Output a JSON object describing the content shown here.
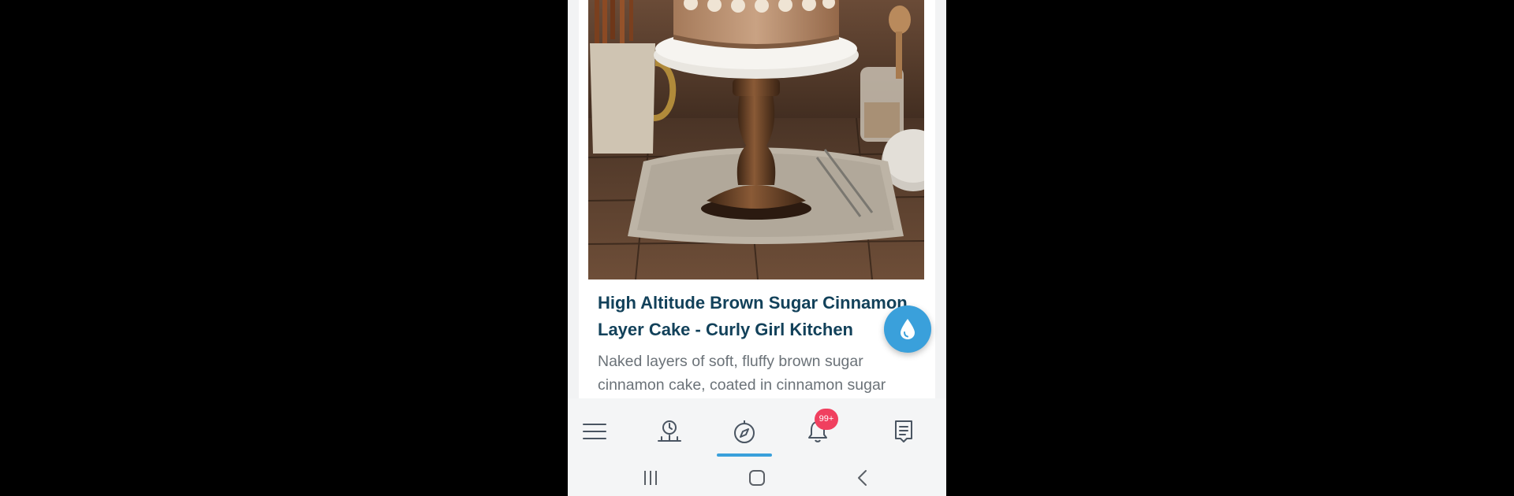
{
  "article": {
    "title": "High Altitude Brown Sugar Cinnamon Layer Cake - Curly Girl Kitchen",
    "description": "Naked layers of soft, fluffy brown sugar cinnamon cake, coated in cinnamon sugar",
    "image_alt": "Brown sugar cinnamon layer cake on a marble and wood cake stand"
  },
  "fab": {
    "icon": "water-drop-icon",
    "color": "#3aa0db"
  },
  "bottom_nav": {
    "items": [
      {
        "id": "menu",
        "icon": "hamburger-menu-icon"
      },
      {
        "id": "timeline",
        "icon": "clock-timeline-icon"
      },
      {
        "id": "discover",
        "icon": "compass-icon",
        "active": true
      },
      {
        "id": "notifications",
        "icon": "bell-icon",
        "badge": "99+"
      },
      {
        "id": "notes",
        "icon": "note-icon"
      }
    ],
    "accent_color": "#3aa0db",
    "badge_color": "#f0405f"
  },
  "system_nav": {
    "items": [
      {
        "id": "recents",
        "icon": "recents-icon"
      },
      {
        "id": "home",
        "icon": "home-icon"
      },
      {
        "id": "back",
        "icon": "back-icon"
      }
    ]
  },
  "colors": {
    "title": "#12415a",
    "description": "#6b7278",
    "background": "#f2f3f4"
  }
}
